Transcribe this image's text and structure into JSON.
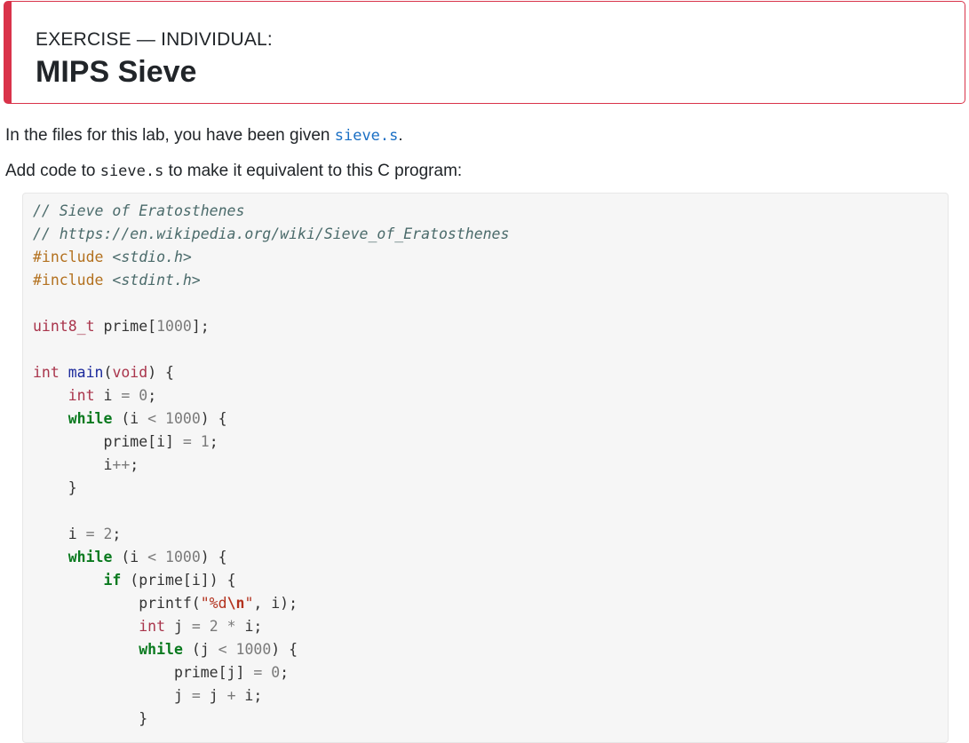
{
  "exercise": {
    "kicker": "EXERCISE — INDIVIDUAL:",
    "title": "MIPS Sieve",
    "accent_color": "#d9334a"
  },
  "intro": {
    "prefix": "In the files for this lab, you have been given ",
    "file_link": "sieve.s",
    "suffix": "."
  },
  "instruction": {
    "prefix": "Add code to ",
    "file_code": "sieve.s",
    "suffix": " to make it equivalent to this C program:"
  },
  "code_lines": [
    [
      {
        "t": "// Sieve of Eratosthenes",
        "c": "cm"
      }
    ],
    [
      {
        "t": "// https://en.wikipedia.org/wiki/Sieve_of_Eratosthenes",
        "c": "cm"
      }
    ],
    [
      {
        "t": "#include ",
        "c": "pp"
      },
      {
        "t": "<stdio.h>",
        "c": "cm"
      }
    ],
    [
      {
        "t": "#include ",
        "c": "pp"
      },
      {
        "t": "<stdint.h>",
        "c": "cm"
      }
    ],
    [],
    [
      {
        "t": "uint8_t",
        "c": "kt"
      },
      {
        "t": " prime[",
        "c": ""
      },
      {
        "t": "1000",
        "c": "num"
      },
      {
        "t": "];",
        "c": ""
      }
    ],
    [],
    [
      {
        "t": "int",
        "c": "kt"
      },
      {
        "t": " ",
        "c": ""
      },
      {
        "t": "main",
        "c": "fn"
      },
      {
        "t": "(",
        "c": ""
      },
      {
        "t": "void",
        "c": "kt"
      },
      {
        "t": ") {",
        "c": ""
      }
    ],
    [
      {
        "t": "    ",
        "c": ""
      },
      {
        "t": "int",
        "c": "kt"
      },
      {
        "t": " i ",
        "c": ""
      },
      {
        "t": "=",
        "c": "op"
      },
      {
        "t": " ",
        "c": ""
      },
      {
        "t": "0",
        "c": "num"
      },
      {
        "t": ";",
        "c": ""
      }
    ],
    [
      {
        "t": "    ",
        "c": ""
      },
      {
        "t": "while",
        "c": "kw"
      },
      {
        "t": " (i ",
        "c": ""
      },
      {
        "t": "<",
        "c": "op"
      },
      {
        "t": " ",
        "c": ""
      },
      {
        "t": "1000",
        "c": "num"
      },
      {
        "t": ") {",
        "c": ""
      }
    ],
    [
      {
        "t": "        prime[i] ",
        "c": ""
      },
      {
        "t": "=",
        "c": "op"
      },
      {
        "t": " ",
        "c": ""
      },
      {
        "t": "1",
        "c": "num"
      },
      {
        "t": ";",
        "c": ""
      }
    ],
    [
      {
        "t": "        i",
        "c": ""
      },
      {
        "t": "++",
        "c": "op"
      },
      {
        "t": ";",
        "c": ""
      }
    ],
    [
      {
        "t": "    }",
        "c": ""
      }
    ],
    [],
    [
      {
        "t": "    i ",
        "c": ""
      },
      {
        "t": "=",
        "c": "op"
      },
      {
        "t": " ",
        "c": ""
      },
      {
        "t": "2",
        "c": "num"
      },
      {
        "t": ";",
        "c": ""
      }
    ],
    [
      {
        "t": "    ",
        "c": ""
      },
      {
        "t": "while",
        "c": "kw"
      },
      {
        "t": " (i ",
        "c": ""
      },
      {
        "t": "<",
        "c": "op"
      },
      {
        "t": " ",
        "c": ""
      },
      {
        "t": "1000",
        "c": "num"
      },
      {
        "t": ") {",
        "c": ""
      }
    ],
    [
      {
        "t": "        ",
        "c": ""
      },
      {
        "t": "if",
        "c": "kw"
      },
      {
        "t": " (prime[i]) {",
        "c": ""
      }
    ],
    [
      {
        "t": "            printf(",
        "c": ""
      },
      {
        "t": "\"%d",
        "c": "str"
      },
      {
        "t": "\\n",
        "c": "esc"
      },
      {
        "t": "\"",
        "c": "str"
      },
      {
        "t": ", i);",
        "c": ""
      }
    ],
    [
      {
        "t": "            ",
        "c": ""
      },
      {
        "t": "int",
        "c": "kt"
      },
      {
        "t": " j ",
        "c": ""
      },
      {
        "t": "=",
        "c": "op"
      },
      {
        "t": " ",
        "c": ""
      },
      {
        "t": "2",
        "c": "num"
      },
      {
        "t": " ",
        "c": ""
      },
      {
        "t": "*",
        "c": "op"
      },
      {
        "t": " i;",
        "c": ""
      }
    ],
    [
      {
        "t": "            ",
        "c": ""
      },
      {
        "t": "while",
        "c": "kw"
      },
      {
        "t": " (j ",
        "c": ""
      },
      {
        "t": "<",
        "c": "op"
      },
      {
        "t": " ",
        "c": ""
      },
      {
        "t": "1000",
        "c": "num"
      },
      {
        "t": ") {",
        "c": ""
      }
    ],
    [
      {
        "t": "                prime[j] ",
        "c": ""
      },
      {
        "t": "=",
        "c": "op"
      },
      {
        "t": " ",
        "c": ""
      },
      {
        "t": "0",
        "c": "num"
      },
      {
        "t": ";",
        "c": ""
      }
    ],
    [
      {
        "t": "                j ",
        "c": ""
      },
      {
        "t": "=",
        "c": "op"
      },
      {
        "t": " j ",
        "c": ""
      },
      {
        "t": "+",
        "c": "op"
      },
      {
        "t": " i;",
        "c": ""
      }
    ],
    [
      {
        "t": "            }",
        "c": ""
      }
    ]
  ]
}
